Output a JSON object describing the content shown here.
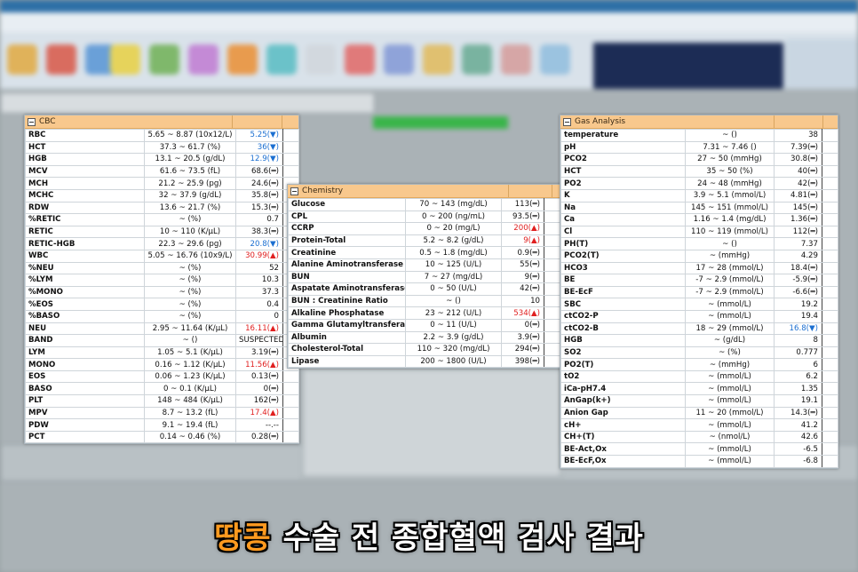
{
  "caption": {
    "highlight": "땅콩",
    "rest": " 수술 전 종합혈액 검사 결과"
  },
  "cbc": {
    "title": "CBC",
    "rows": [
      {
        "name": "RBC",
        "range": "5.65 ~ 8.87 (10x12/L)",
        "result": "5.25(▼)",
        "flag": "low"
      },
      {
        "name": "HCT",
        "range": "37.3 ~ 61.7 (%)",
        "result": "36(▼)",
        "flag": "low"
      },
      {
        "name": "HGB",
        "range": "13.1 ~ 20.5 (g/dL)",
        "result": "12.9(▼)",
        "flag": "low"
      },
      {
        "name": "MCV",
        "range": "61.6 ~ 73.5 (fL)",
        "result": "68.6(═)",
        "flag": "normal"
      },
      {
        "name": "MCH",
        "range": "21.2 ~ 25.9 (pg)",
        "result": "24.6(═)",
        "flag": "normal"
      },
      {
        "name": "MCHC",
        "range": "32 ~ 37.9 (g/dL)",
        "result": "35.8(═)",
        "flag": "normal"
      },
      {
        "name": "RDW",
        "range": "13.6 ~ 21.7 (%)",
        "result": "15.3(═)",
        "flag": "normal"
      },
      {
        "name": "%RETIC",
        "range": "~ (%)",
        "result": "0.7",
        "flag": "normal"
      },
      {
        "name": "RETIC",
        "range": "10 ~ 110 (K/μL)",
        "result": "38.3(═)",
        "flag": "normal"
      },
      {
        "name": "RETIC-HGB",
        "range": "22.3 ~ 29.6 (pg)",
        "result": "20.8(▼)",
        "flag": "low"
      },
      {
        "name": "WBC",
        "range": "5.05 ~ 16.76 (10x9/L)",
        "result": "30.99(▲)",
        "flag": "high"
      },
      {
        "name": "%NEU",
        "range": "~ (%)",
        "result": "52",
        "flag": "normal"
      },
      {
        "name": "%LYM",
        "range": "~ (%)",
        "result": "10.3",
        "flag": "normal"
      },
      {
        "name": "%MONO",
        "range": "~ (%)",
        "result": "37.3",
        "flag": "normal"
      },
      {
        "name": "%EOS",
        "range": "~ (%)",
        "result": "0.4",
        "flag": "normal"
      },
      {
        "name": "%BASO",
        "range": "~ (%)",
        "result": "0",
        "flag": "normal"
      },
      {
        "name": "NEU",
        "range": "2.95 ~ 11.64 (K/μL)",
        "result": "16.11(▲)",
        "flag": "high"
      },
      {
        "name": "BAND",
        "range": "~ ()",
        "result": "SUSPECTED",
        "flag": "normal"
      },
      {
        "name": "LYM",
        "range": "1.05 ~ 5.1 (K/μL)",
        "result": "3.19(═)",
        "flag": "normal"
      },
      {
        "name": "MONO",
        "range": "0.16 ~ 1.12 (K/μL)",
        "result": "11.56(▲)",
        "flag": "high"
      },
      {
        "name": "EOS",
        "range": "0.06 ~ 1.23 (K/μL)",
        "result": "0.13(═)",
        "flag": "normal"
      },
      {
        "name": "BASO",
        "range": "0 ~ 0.1 (K/μL)",
        "result": "0(═)",
        "flag": "normal"
      },
      {
        "name": "PLT",
        "range": "148 ~ 484 (K/μL)",
        "result": "162(═)",
        "flag": "normal"
      },
      {
        "name": "MPV",
        "range": "8.7 ~ 13.2 (fL)",
        "result": "17.4(▲)",
        "flag": "high"
      },
      {
        "name": "PDW",
        "range": "9.1 ~ 19.4 (fL)",
        "result": "--.--",
        "flag": "normal"
      },
      {
        "name": "PCT",
        "range": "0.14 ~ 0.46 (%)",
        "result": "0.28(═)",
        "flag": "normal"
      }
    ]
  },
  "chemistry": {
    "title": "Chemistry",
    "rows": [
      {
        "name": "Glucose",
        "range": "70 ~ 143 (mg/dL)",
        "result": "113(═)",
        "flag": "normal"
      },
      {
        "name": "CPL",
        "range": "0 ~ 200 (ng/mL)",
        "result": "93.5(═)",
        "flag": "normal"
      },
      {
        "name": "CCRP",
        "range": "0 ~ 20 (mg/L)",
        "result": "200(▲)",
        "flag": "high"
      },
      {
        "name": "Protein-Total",
        "range": "5.2 ~ 8.2 (g/dL)",
        "result": "9(▲)",
        "flag": "high"
      },
      {
        "name": "Creatinine",
        "range": "0.5 ~ 1.8 (mg/dL)",
        "result": "0.9(═)",
        "flag": "normal"
      },
      {
        "name": "Alanine Aminotransferase",
        "range": "10 ~ 125 (U/L)",
        "result": "55(═)",
        "flag": "normal"
      },
      {
        "name": "BUN",
        "range": "7 ~ 27 (mg/dL)",
        "result": "9(═)",
        "flag": "normal"
      },
      {
        "name": "Aspatate Aminotransferase",
        "range": "0 ~ 50 (U/L)",
        "result": "42(═)",
        "flag": "normal"
      },
      {
        "name": "BUN : Creatinine Ratio",
        "range": "~ ()",
        "result": "10",
        "flag": "normal"
      },
      {
        "name": "Alkaline Phosphatase",
        "range": "23 ~ 212 (U/L)",
        "result": "534(▲)",
        "flag": "high"
      },
      {
        "name": "Gamma Glutamyltransferase",
        "range": "0 ~ 11 (U/L)",
        "result": "0(═)",
        "flag": "normal"
      },
      {
        "name": "Albumin",
        "range": "2.2 ~ 3.9 (g/dL)",
        "result": "3.9(═)",
        "flag": "normal"
      },
      {
        "name": "Cholesterol-Total",
        "range": "110 ~ 320 (mg/dL)",
        "result": "294(═)",
        "flag": "normal"
      },
      {
        "name": "Lipase",
        "range": "200 ~ 1800 (U/L)",
        "result": "398(═)",
        "flag": "normal"
      }
    ]
  },
  "gas": {
    "title": "Gas Analysis",
    "rows": [
      {
        "name": "temperature",
        "range": "~ ()",
        "result": "38",
        "flag": "normal"
      },
      {
        "name": "pH",
        "range": "7.31 ~ 7.46 ()",
        "result": "7.39(═)",
        "flag": "normal"
      },
      {
        "name": "PCO2",
        "range": "27 ~ 50 (mmHg)",
        "result": "30.8(═)",
        "flag": "normal"
      },
      {
        "name": "HCT",
        "range": "35 ~ 50 (%)",
        "result": "40(═)",
        "flag": "normal"
      },
      {
        "name": "PO2",
        "range": "24 ~ 48 (mmHg)",
        "result": "42(═)",
        "flag": "normal"
      },
      {
        "name": "K",
        "range": "3.9 ~ 5.1 (mmol/L)",
        "result": "4.81(═)",
        "flag": "normal"
      },
      {
        "name": "Na",
        "range": "145 ~ 151 (mmol/L)",
        "result": "145(═)",
        "flag": "normal"
      },
      {
        "name": "Ca",
        "range": "1.16 ~ 1.4 (mg/dL)",
        "result": "1.36(═)",
        "flag": "normal"
      },
      {
        "name": "Cl",
        "range": "110 ~ 119 (mmol/L)",
        "result": "112(═)",
        "flag": "normal"
      },
      {
        "name": "PH(T)",
        "range": "~ ()",
        "result": "7.37",
        "flag": "normal"
      },
      {
        "name": "PCO2(T)",
        "range": "~ (mmHg)",
        "result": "4.29",
        "flag": "normal"
      },
      {
        "name": "HCO3",
        "range": "17 ~ 28 (mmol/L)",
        "result": "18.4(═)",
        "flag": "normal"
      },
      {
        "name": "BE",
        "range": "-7 ~ 2.9 (mmol/L)",
        "result": "-5.9(═)",
        "flag": "normal"
      },
      {
        "name": "BE-EcF",
        "range": "-7 ~ 2.9 (mmol/L)",
        "result": "-6.6(═)",
        "flag": "normal"
      },
      {
        "name": "SBC",
        "range": "~ (mmol/L)",
        "result": "19.2",
        "flag": "normal"
      },
      {
        "name": "ctCO2-P",
        "range": "~ (mmol/L)",
        "result": "19.4",
        "flag": "normal"
      },
      {
        "name": "ctCO2-B",
        "range": "18 ~ 29 (mmol/L)",
        "result": "16.8(▼)",
        "flag": "low"
      },
      {
        "name": "HGB",
        "range": "~ (g/dL)",
        "result": "8",
        "flag": "normal"
      },
      {
        "name": "SO2",
        "range": "~ (%)",
        "result": "0.777",
        "flag": "normal"
      },
      {
        "name": "PO2(T)",
        "range": "~ (mmHg)",
        "result": "6",
        "flag": "normal"
      },
      {
        "name": "tO2",
        "range": "~ (mmol/L)",
        "result": "6.2",
        "flag": "normal"
      },
      {
        "name": "iCa-pH7.4",
        "range": "~ (mmol/L)",
        "result": "1.35",
        "flag": "normal"
      },
      {
        "name": "AnGap(k+)",
        "range": "~ (mmol/L)",
        "result": "19.1",
        "flag": "normal"
      },
      {
        "name": "Anion Gap",
        "range": "11 ~ 20 (mmol/L)",
        "result": "14.3(═)",
        "flag": "normal"
      },
      {
        "name": "cH+",
        "range": "~ (mmol/L)",
        "result": "41.2",
        "flag": "normal"
      },
      {
        "name": "CH+(T)",
        "range": "~ (nmol/L)",
        "result": "42.6",
        "flag": "normal"
      },
      {
        "name": "BE-Act,Ox",
        "range": "~ (mmol/L)",
        "result": "-6.5",
        "flag": "normal"
      },
      {
        "name": "BE-EcF,Ox",
        "range": "~ (mmol/L)",
        "result": "-6.8",
        "flag": "normal"
      }
    ]
  },
  "colors": {
    "header": "#f8c88d",
    "low": "#1b6fd1",
    "high": "#e02020",
    "caption_highlight": "#ff9a1f"
  }
}
